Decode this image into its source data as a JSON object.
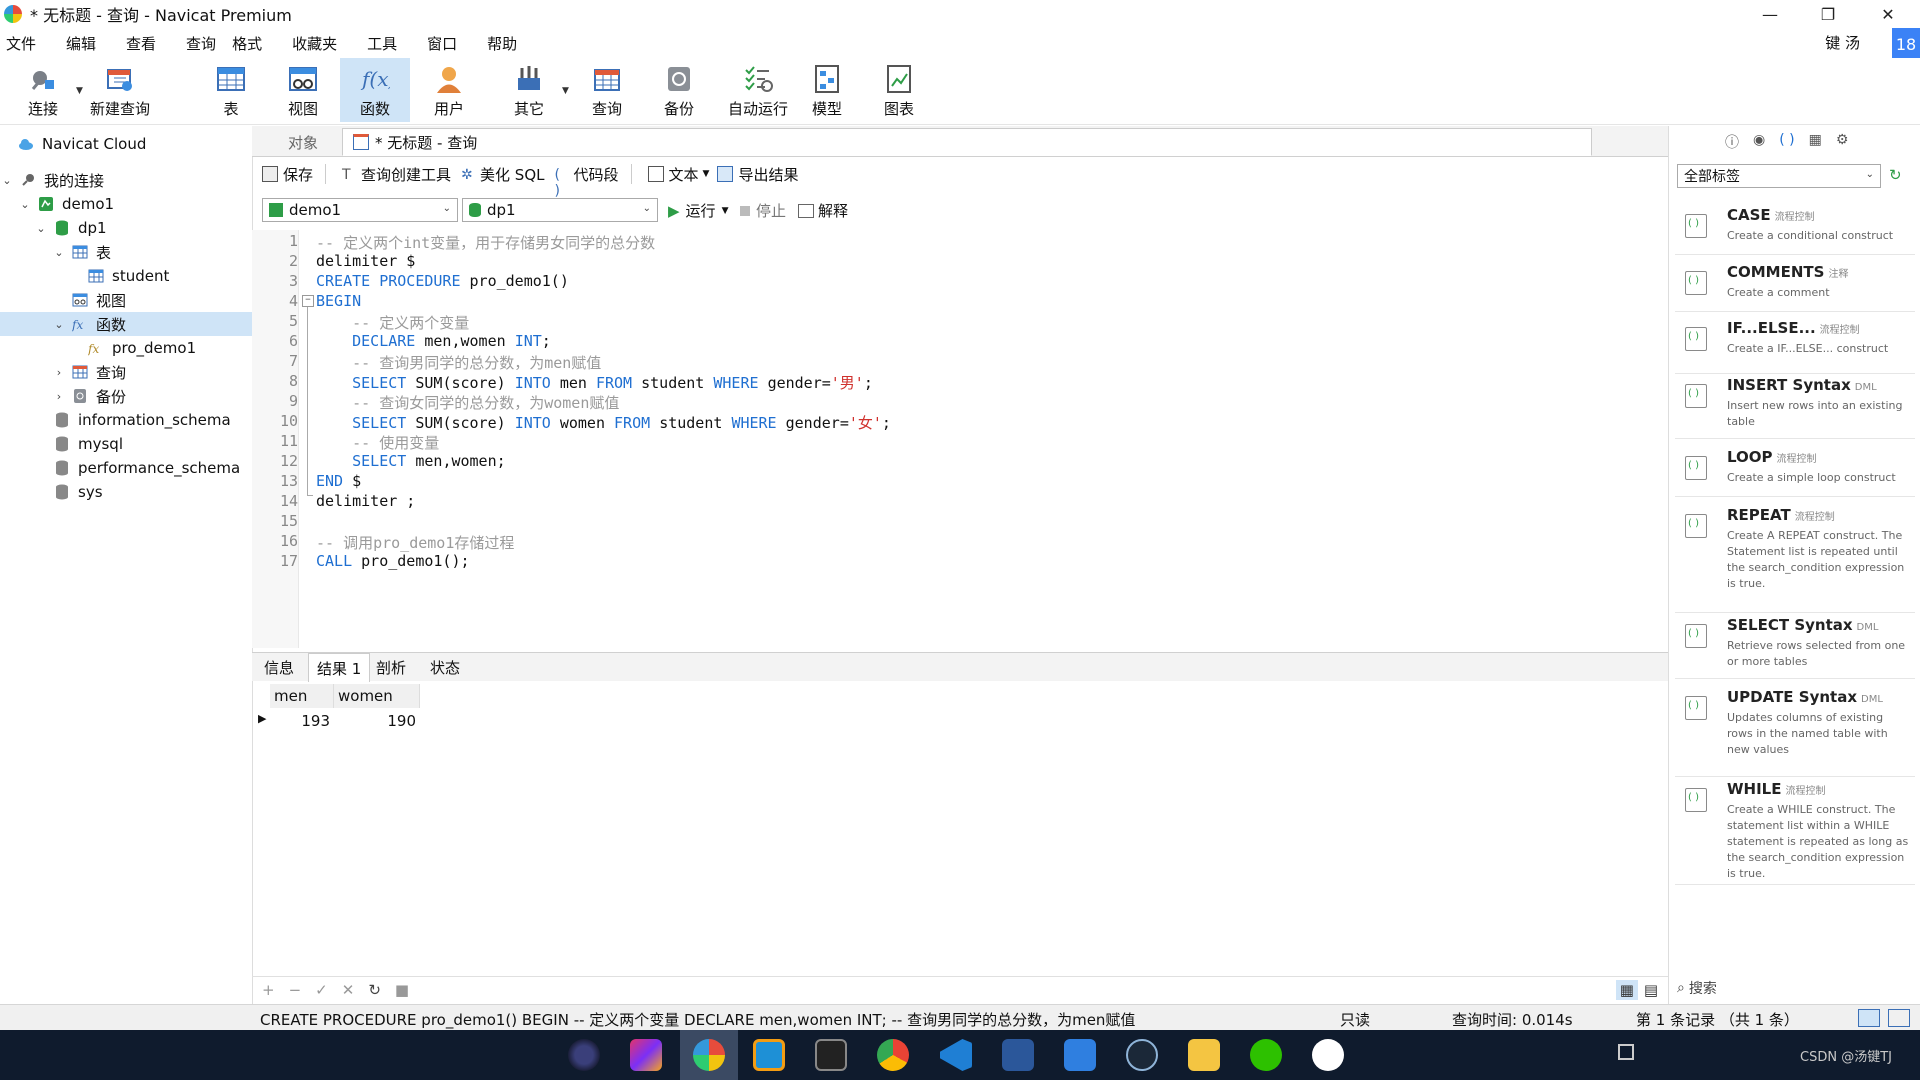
{
  "window": {
    "title": "* 无标题 - 查询 - Navicat Premium",
    "min_glyph": "—",
    "max_glyph": "❐",
    "close_glyph": "✕"
  },
  "menu": [
    "文件",
    "编辑",
    "查看",
    "查询",
    "格式",
    "收藏夹",
    "工具",
    "窗口",
    "帮助"
  ],
  "user": {
    "name": "键 汤",
    "badge": "18"
  },
  "toolbar": [
    {
      "label": "连接"
    },
    {
      "label": "新建查询"
    },
    {
      "label": "表"
    },
    {
      "label": "视图"
    },
    {
      "label": "函数",
      "active": true
    },
    {
      "label": "用户"
    },
    {
      "label": "其它"
    },
    {
      "label": "查询"
    },
    {
      "label": "备份"
    },
    {
      "label": "自动运行"
    },
    {
      "label": "模型"
    },
    {
      "label": "图表"
    }
  ],
  "tree": {
    "cloud": "Navicat Cloud",
    "my_connections": "我的连接",
    "connection": "demo1",
    "database": "dp1",
    "tables": "表",
    "table_student": "student",
    "views": "视图",
    "functions": "函数",
    "func_item": "pro_demo1",
    "queries": "查询",
    "backups": "备份",
    "dbs": [
      "information_schema",
      "mysql",
      "performance_schema",
      "sys"
    ]
  },
  "tabs": {
    "objects": "对象",
    "query": "* 无标题 - 查询"
  },
  "query_toolbar": {
    "save": "保存",
    "builder": "查询创建工具",
    "beautify": "美化 SQL",
    "snippet": "代码段",
    "text": "文本",
    "export": "导出结果"
  },
  "selectors": {
    "connection": "demo1",
    "database": "dp1",
    "run": "运行",
    "stop": "停止",
    "explain": "解释"
  },
  "code": [
    "-- 定义两个int变量，用于存储男女同学的总分数",
    "delimiter $",
    "CREATE PROCEDURE pro_demo1()",
    "BEGIN",
    "    -- 定义两个变量",
    "    DECLARE men,women INT;",
    "    -- 查询男同学的总分数，为men赋值",
    "    SELECT SUM(score) INTO men FROM student WHERE gender='男';",
    "    -- 查询女同学的总分数，为women赋值",
    "    SELECT SUM(score) INTO women FROM student WHERE gender='女';",
    "    -- 使用变量",
    "    SELECT men,women;",
    "END $",
    "delimiter ;",
    "",
    "-- 调用pro_demo1存储过程",
    "CALL pro_demo1();"
  ],
  "result_tabs": [
    "信息",
    "结果 1",
    "剖析",
    "状态"
  ],
  "result": {
    "columns": [
      "men",
      "women"
    ],
    "rows": [
      [
        "193",
        "190"
      ]
    ]
  },
  "right_pane": {
    "filter": "全部标签",
    "search_placeholder": "搜索",
    "snippets": [
      {
        "title": "CASE",
        "tag": "流程控制",
        "desc": "Create a conditional construct"
      },
      {
        "title": "COMMENTS",
        "tag": "注释",
        "desc": "Create a comment"
      },
      {
        "title": "IF...ELSE...",
        "tag": "流程控制",
        "desc": "Create a IF...ELSE... construct"
      },
      {
        "title": "INSERT Syntax",
        "tag": "DML",
        "desc": "Insert new rows into an existing table"
      },
      {
        "title": "LOOP",
        "tag": "流程控制",
        "desc": "Create a simple loop construct"
      },
      {
        "title": "REPEAT",
        "tag": "流程控制",
        "desc": "Create A REPEAT construct. The Statement list is repeated until the search_condition expression is true."
      },
      {
        "title": "SELECT Syntax",
        "tag": "DML",
        "desc": "Retrieve rows selected from one or more tables"
      },
      {
        "title": "UPDATE Syntax",
        "tag": "DML",
        "desc": "Updates columns of existing rows in the named table with new values"
      },
      {
        "title": "WHILE",
        "tag": "流程控制",
        "desc": "Create a WHILE construct. The statement list within a WHILE statement is repeated as long as the search_condition expression is true."
      }
    ]
  },
  "status": {
    "sql": "CREATE PROCEDURE pro_demo1() BEGIN    -- 定义两个变量    DECLARE men,women INT;                -- 查询男同学的总分数，为men赋值",
    "readonly": "只读",
    "time": "查询时间: 0.014s",
    "records": "第 1 条记录 （共 1 条）"
  },
  "watermark": "CSDN @汤键TJ",
  "colors": {
    "accent": "#cfe4f7",
    "keyword": "#1f6fd1",
    "comment": "#9a9a9a",
    "string": "#d0312d",
    "taskbar": "#0f1b2d"
  }
}
